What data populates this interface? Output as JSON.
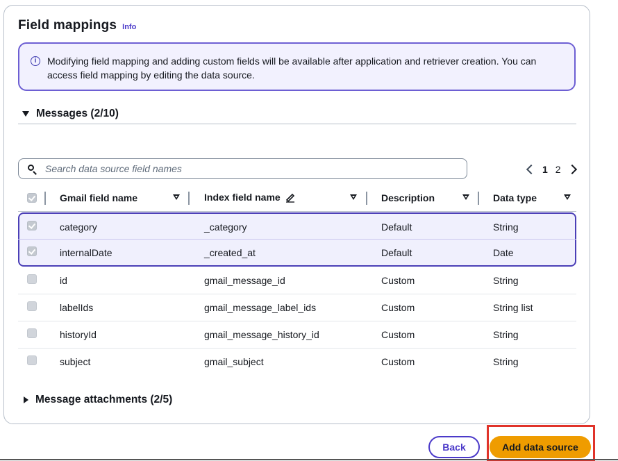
{
  "panel": {
    "title": "Field mappings",
    "info_link": "Info"
  },
  "alert": {
    "icon": "info-circle-icon",
    "text": "Modifying field mapping and adding custom fields will be available after application and retriever creation. You can access field mapping by editing the data source."
  },
  "messages_section": {
    "label": "Messages (2/10)",
    "expanded": true
  },
  "search": {
    "placeholder": "Search data source field names",
    "value": ""
  },
  "pagination": {
    "pages": [
      "1",
      "2"
    ],
    "current": "1"
  },
  "table": {
    "columns": {
      "gmail_field": "Gmail field name",
      "index_field": "Index field name",
      "description": "Description",
      "data_type": "Data type"
    },
    "rows": [
      {
        "gmail": "category",
        "index": "_category",
        "desc": "Default",
        "type": "String",
        "checked": true
      },
      {
        "gmail": "internalDate",
        "index": "_created_at",
        "desc": "Default",
        "type": "Date",
        "checked": true
      },
      {
        "gmail": "id",
        "index": "gmail_message_id",
        "desc": "Custom",
        "type": "String",
        "checked": false
      },
      {
        "gmail": "labelIds",
        "index": "gmail_message_label_ids",
        "desc": "Custom",
        "type": "String list",
        "checked": false
      },
      {
        "gmail": "historyId",
        "index": "gmail_message_history_id",
        "desc": "Custom",
        "type": "String",
        "checked": false
      },
      {
        "gmail": "subject",
        "index": "gmail_subject",
        "desc": "Custom",
        "type": "String",
        "checked": false
      }
    ]
  },
  "attachments_section": {
    "label": "Message attachments (2/5)",
    "expanded": false
  },
  "footer": {
    "back_label": "Back",
    "add_label": "Add data source"
  },
  "colors": {
    "accent": "#4b3ac9",
    "primary_button": "#ef9c00",
    "highlight": "#e0332a"
  }
}
